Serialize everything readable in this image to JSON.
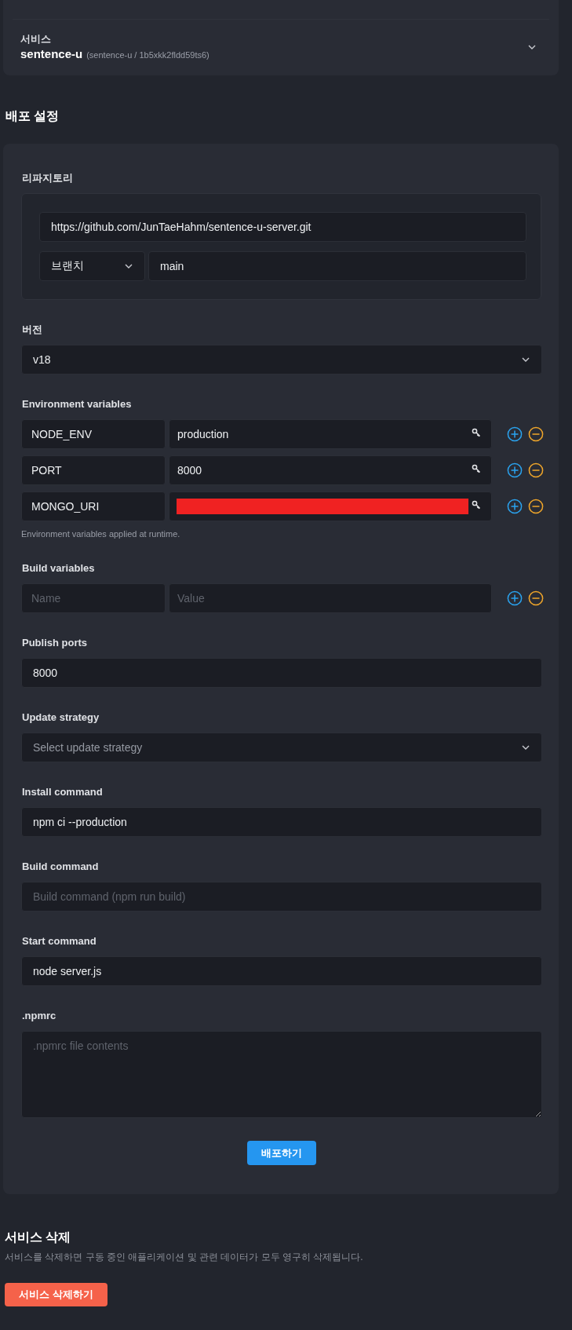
{
  "service_panel": {
    "label": "서비스",
    "name": "sentence-u",
    "detail": "(sentence-u / 1b5xkk2fldd59ts6)",
    "expanded": false
  },
  "deploy_settings": {
    "title": "배포 설정",
    "sections": [
      {
        "kind": "repository",
        "label": "리파지토리",
        "url": "https://github.com/JunTaeHahm/sentence-u-server.git",
        "branch_select": "브랜치",
        "branch": "main"
      },
      {
        "kind": "select",
        "label": "버전",
        "value": "v18"
      },
      {
        "kind": "variables",
        "label": "Environment variables",
        "secrets": true,
        "rows": [
          {
            "name": "NODE_ENV",
            "value": "production",
            "redacted": false
          },
          {
            "name": "PORT",
            "value": "8000",
            "redacted": false
          },
          {
            "name": "MONGO_URI",
            "redacted": true
          }
        ],
        "help": "Environment variables applied at runtime."
      },
      {
        "kind": "variables",
        "label": "Build variables",
        "secrets": false,
        "rows": [
          {
            "name_placeholder": "Name",
            "value_placeholder": "Value",
            "redacted": false
          }
        ]
      },
      {
        "kind": "input",
        "label": "Publish ports",
        "value": "8000"
      },
      {
        "kind": "select",
        "label": "Update strategy",
        "placeholder": "Select update strategy"
      },
      {
        "kind": "input",
        "label": "Install command",
        "value": "npm ci --production"
      },
      {
        "kind": "input",
        "label": "Build command",
        "placeholder": "Build command (npm run build)"
      },
      {
        "kind": "input",
        "label": "Start command",
        "value": "node server.js"
      },
      {
        "kind": "textarea",
        "label": ".npmrc",
        "placeholder": ".npmrc file contents"
      }
    ],
    "submit": "배포하기"
  },
  "delete_service": {
    "title": "서비스 삭제",
    "description": "서비스를 삭제하면 구동 중인 애플리케이션 및 관련 데이터가 모두 영구히 삭제됩니다.",
    "button": "서비스 삭제하기"
  }
}
